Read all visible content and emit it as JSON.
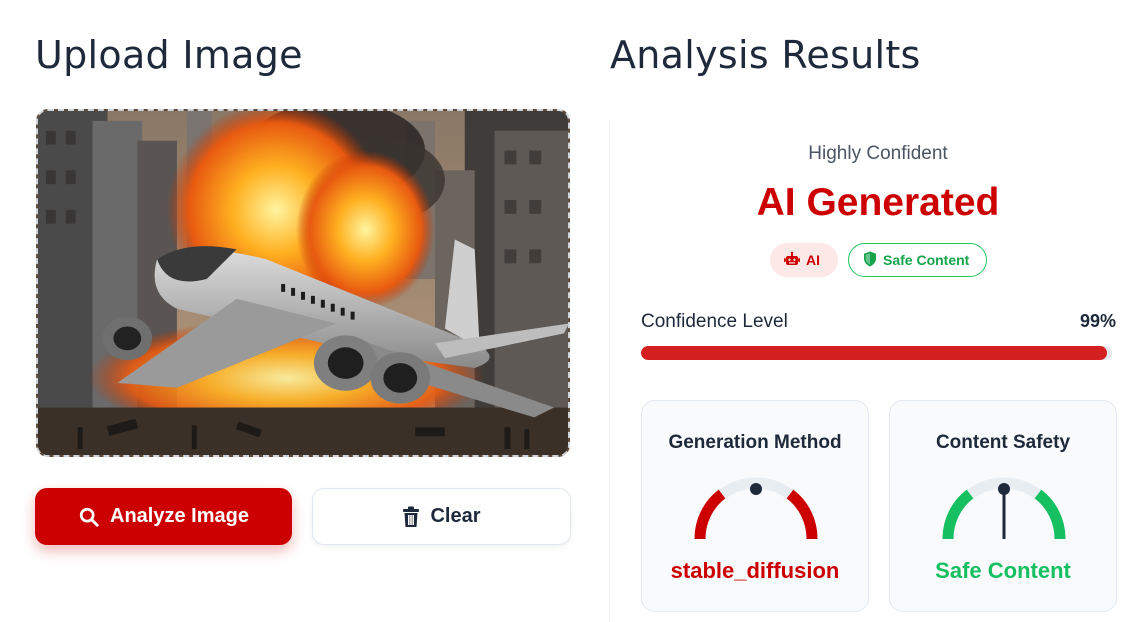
{
  "upload": {
    "heading": "Upload Image",
    "image_alt": "Burning airplane crashed in a city street",
    "analyze_label": "Analyze Image",
    "clear_label": "Clear"
  },
  "results": {
    "heading": "Analysis Results",
    "confidence_text": "Highly Confident",
    "verdict": "AI Generated",
    "badges": [
      {
        "label": "AI",
        "icon": "robot-icon",
        "color": "#cc0000"
      },
      {
        "label": "Safe Content",
        "icon": "shield-icon",
        "color": "#16a34a"
      }
    ],
    "confidence_label": "Confidence Level",
    "confidence_value": "99%",
    "confidence_fraction": 0.99,
    "cards": [
      {
        "title": "Generation Method",
        "value": "stable_diffusion",
        "color": "#cc0000"
      },
      {
        "title": "Content Safety",
        "value": "Safe Content",
        "color": "#16c060"
      }
    ]
  },
  "colors": {
    "accent_red": "#cc0000",
    "safe_green": "#22c55e",
    "text_dark": "#1e293b"
  }
}
